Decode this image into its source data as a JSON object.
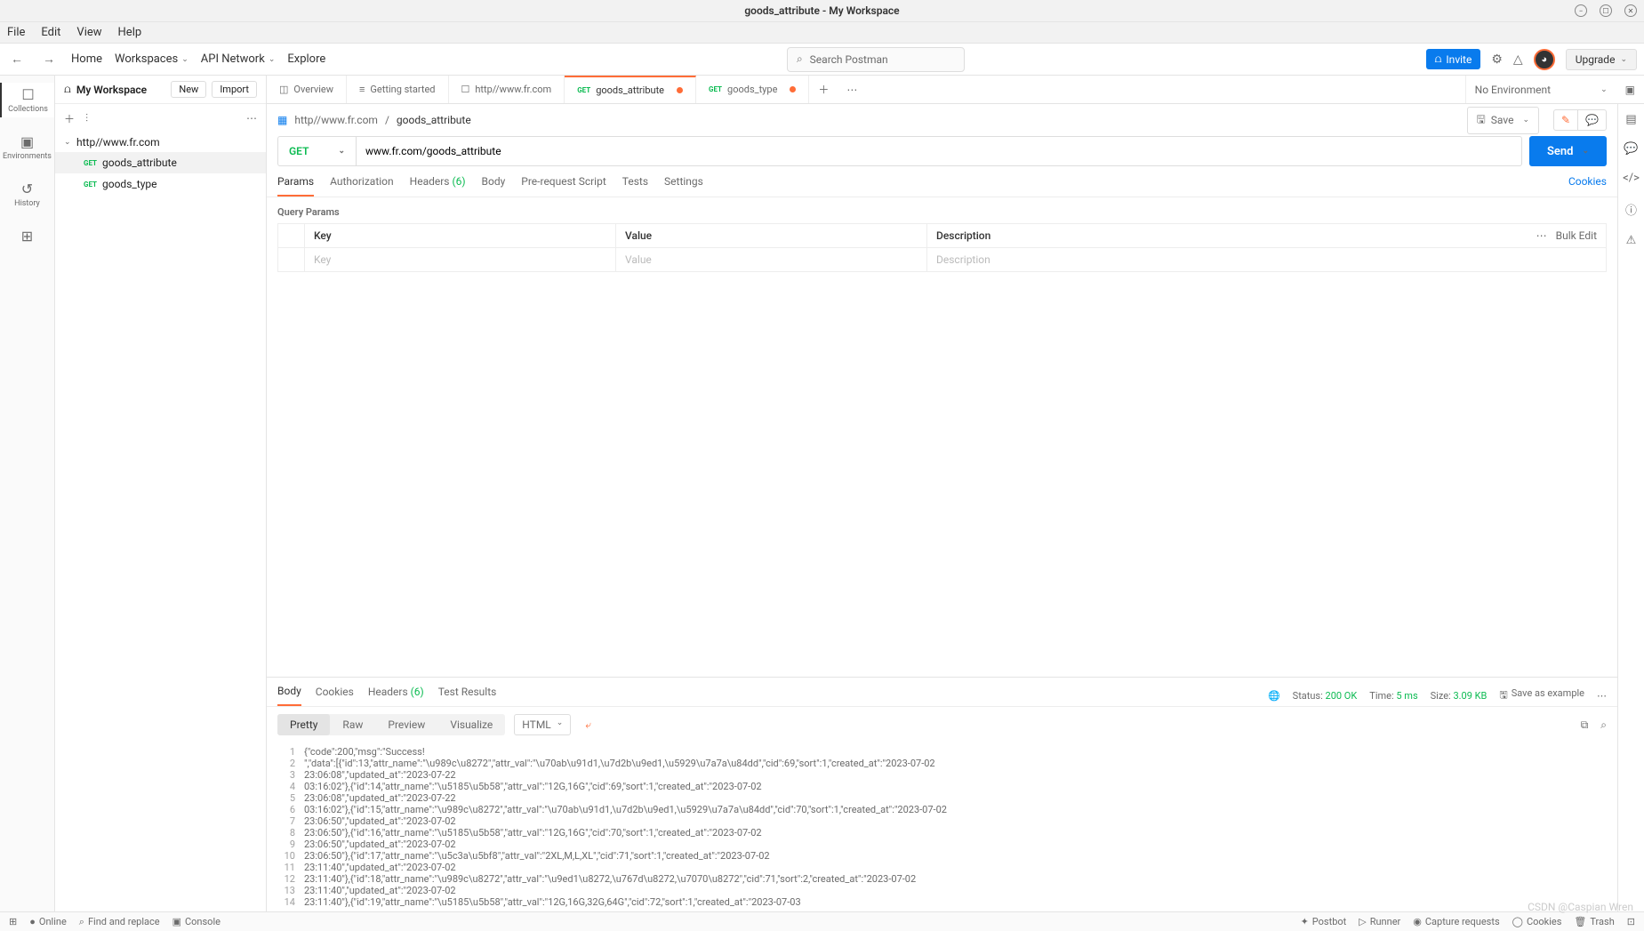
{
  "window": {
    "title": "goods_attribute - My Workspace"
  },
  "menubar": [
    "File",
    "Edit",
    "View",
    "Help"
  ],
  "topnav": {
    "home": "Home",
    "workspaces": "Workspaces",
    "apinet": "API Network",
    "explore": "Explore",
    "search_placeholder": "Search Postman",
    "invite": "Invite",
    "upgrade": "Upgrade"
  },
  "leftbar": [
    {
      "icon": "☐",
      "label": "Collections",
      "active": true
    },
    {
      "icon": "▣",
      "label": "Environments"
    },
    {
      "icon": "↺",
      "label": "History"
    },
    {
      "icon": "⊞",
      "label": ""
    }
  ],
  "sidebar": {
    "workspace": "My Workspace",
    "new": "New",
    "import": "Import",
    "collection": "http//www.fr.com",
    "items": [
      {
        "method": "GET",
        "name": "goods_attribute",
        "selected": true
      },
      {
        "method": "GET",
        "name": "goods_type"
      }
    ]
  },
  "tabs": [
    {
      "icon": "◫",
      "label": "Overview"
    },
    {
      "icon": "≡",
      "label": "Getting started"
    },
    {
      "icon": "☐",
      "label": "http//www.fr.com"
    },
    {
      "method": "GET",
      "label": "goods_attribute",
      "active": true,
      "dirty": true
    },
    {
      "method": "GET",
      "label": "goods_type",
      "dirty": true
    }
  ],
  "env": "No Environment",
  "breadcrumb": {
    "parent": "http//www.fr.com",
    "current": "goods_attribute",
    "save": "Save"
  },
  "request": {
    "method": "GET",
    "url": "www.fr.com/goods_attribute",
    "send": "Send",
    "tabs": [
      "Params",
      "Authorization",
      "Headers",
      "Body",
      "Pre-request Script",
      "Tests",
      "Settings"
    ],
    "headers_count": "(6)",
    "cookies": "Cookies",
    "query_params_label": "Query Params",
    "cols": {
      "key": "Key",
      "value": "Value",
      "description": "Description",
      "bulk": "Bulk Edit"
    },
    "ph": {
      "key": "Key",
      "value": "Value",
      "description": "Description"
    }
  },
  "response": {
    "tabs": [
      "Body",
      "Cookies",
      "Headers",
      "Test Results"
    ],
    "headers_count": "(6)",
    "status_label": "Status:",
    "status_value": "200 OK",
    "time_label": "Time:",
    "time_value": "5 ms",
    "size_label": "Size:",
    "size_value": "3.09 KB",
    "save_example": "Save as example",
    "view_tabs": [
      "Pretty",
      "Raw",
      "Preview",
      "Visualize"
    ],
    "lang": "HTML",
    "lines": [
      "{\"code\":200,\"msg\":\"Success!",
      "\",\"data\":[{\"id\":13,\"attr_name\":\"\\u989c\\u8272\",\"attr_val\":\"\\u70ab\\u91d1,\\u7d2b\\u9ed1,\\u5929\\u7a7a\\u84dd\",\"cid\":69,\"sort\":1,\"created_at\":\"2023-07-02",
      "23:06:08\",\"updated_at\":\"2023-07-22",
      "03:16:02\"},{\"id\":14,\"attr_name\":\"\\u5185\\u5b58\",\"attr_val\":\"12G,16G\",\"cid\":69,\"sort\":1,\"created_at\":\"2023-07-02",
      "23:06:08\",\"updated_at\":\"2023-07-22",
      "03:16:02\"},{\"id\":15,\"attr_name\":\"\\u989c\\u8272\",\"attr_val\":\"\\u70ab\\u91d1,\\u7d2b\\u9ed1,\\u5929\\u7a7a\\u84dd\",\"cid\":70,\"sort\":1,\"created_at\":\"2023-07-02",
      "23:06:50\",\"updated_at\":\"2023-07-02",
      "23:06:50\"},{\"id\":16,\"attr_name\":\"\\u5185\\u5b58\",\"attr_val\":\"12G,16G\",\"cid\":70,\"sort\":1,\"created_at\":\"2023-07-02",
      "23:06:50\",\"updated_at\":\"2023-07-02",
      "23:06:50\"},{\"id\":17,\"attr_name\":\"\\u5c3a\\u5bf8\",\"attr_val\":\"2XL,M,L,XL\",\"cid\":71,\"sort\":1,\"created_at\":\"2023-07-02",
      "23:11:40\",\"updated_at\":\"2023-07-02",
      "23:11:40\"},{\"id\":18,\"attr_name\":\"\\u989c\\u8272\",\"attr_val\":\"\\u9ed1\\u8272,\\u767d\\u8272,\\u7070\\u8272\",\"cid\":71,\"sort\":2,\"created_at\":\"2023-07-02",
      "23:11:40\",\"updated_at\":\"2023-07-02",
      "23:11:40\"},{\"id\":19,\"attr_name\":\"\\u5185\\u5b58\",\"attr_val\":\"12G,16G,32G,64G\",\"cid\":72,\"sort\":1,\"created_at\":\"2023-07-03"
    ]
  },
  "footer": {
    "left": [
      "⊞",
      "Online",
      "Find and replace",
      "Console"
    ],
    "right": [
      "Postbot",
      "Runner",
      "Capture requests",
      "Cookies",
      "Trash",
      "⊡"
    ]
  },
  "watermark": "CSDN @Caspian Wren"
}
